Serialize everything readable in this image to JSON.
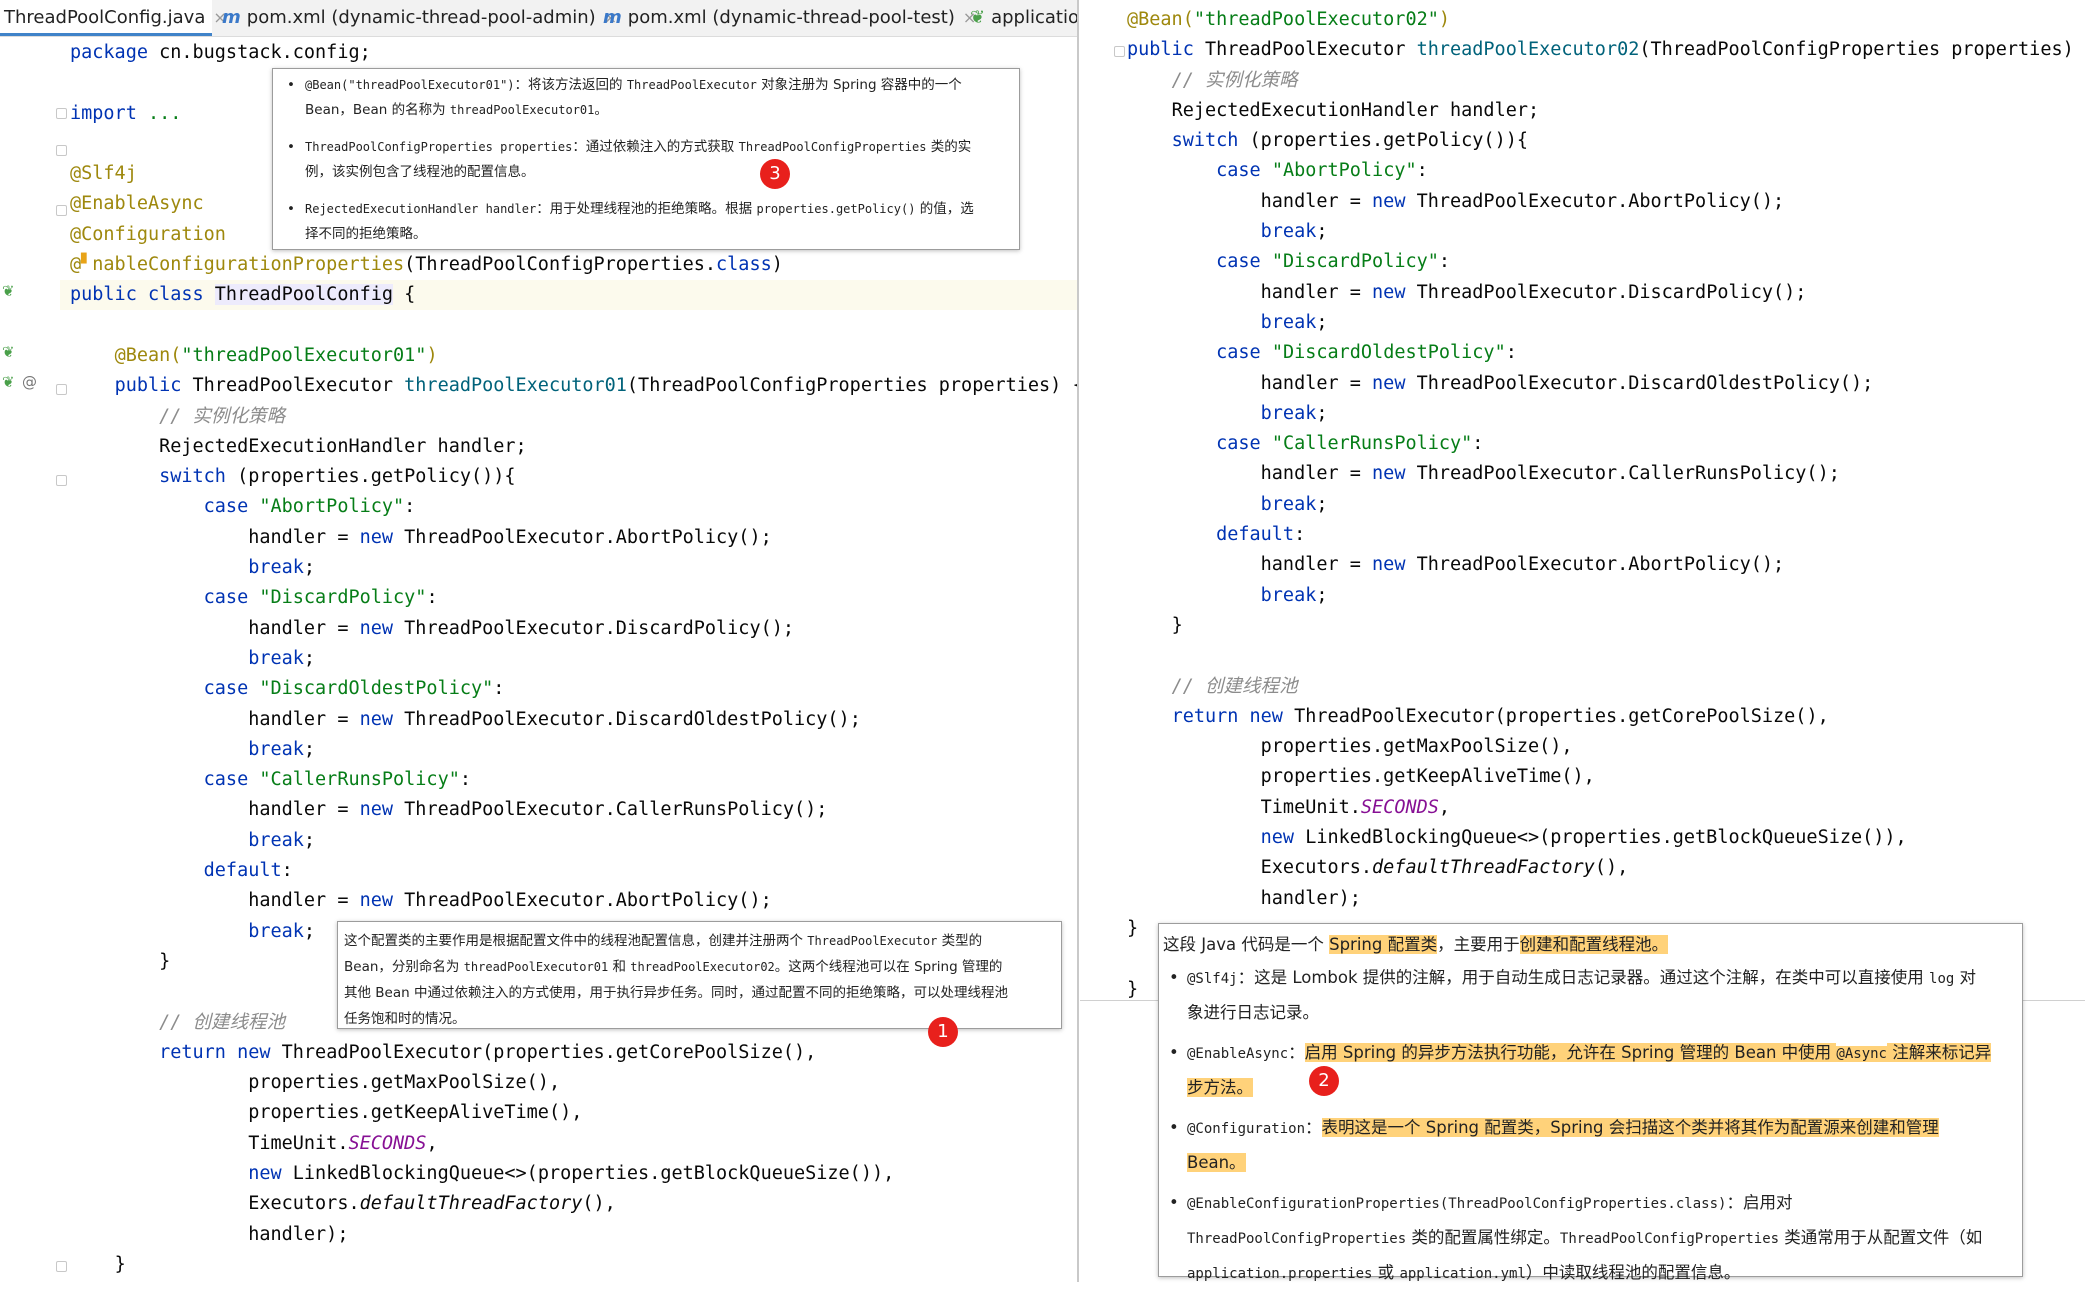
{
  "tabs": [
    {
      "label": "ThreadPoolConfig.java",
      "icon": "java-file-icon"
    },
    {
      "label": "pom.xml (dynamic-thread-pool-admin)",
      "icon": "maven-file-icon"
    },
    {
      "label": "pom.xml (dynamic-thread-pool-test)",
      "icon": "maven-file-icon"
    },
    {
      "label": "applicatio",
      "icon": "spring-config-icon"
    }
  ],
  "code": {
    "package_kw": "package",
    "package_name": "cn.bugstack.config;",
    "import_kw": "import",
    "import_dots": "...",
    "ann_slf4j": "@Slf4j",
    "ann_async": "@EnableAsync",
    "ann_config": "@Configuration",
    "ann_ecp_head": "@",
    "ann_ecp_tail": "nableConfigurationProperties",
    "ecp_arg": "(ThreadPoolConfigProperties.",
    "class_kw": "class",
    "ecp_close": ")",
    "public_class": "public class",
    "class_name": "ThreadPoolConfig",
    "open_brace": "{",
    "bean_ann": "@Bean(",
    "bean_name1": "\"threadPoolExecutor01\"",
    "bean_name2": "\"threadPoolExecutor02\"",
    "close_paren": ")",
    "public_kw": "public",
    "return_type": "ThreadPoolExecutor",
    "method1": "threadPoolExecutor01",
    "method2": "threadPoolExecutor02",
    "params": "(ThreadPoolConfigProperties properties) {",
    "comment_instantiate": "// 实例化策略",
    "handler_decl": "RejectedExecutionHandler handler;",
    "switch_kw": "switch",
    "switch_expr": "(properties.getPolicy()){",
    "case_kw": "case",
    "cases": [
      {
        "label": "\"AbortPolicy\"",
        "ctor": "ThreadPoolExecutor.AbortPolicy();"
      },
      {
        "label": "\"DiscardPolicy\"",
        "ctor": "ThreadPoolExecutor.DiscardPolicy();"
      },
      {
        "label": "\"DiscardOldestPolicy\"",
        "ctor": "ThreadPoolExecutor.DiscardOldestPolicy();"
      },
      {
        "label": "\"CallerRunsPolicy\"",
        "ctor": "ThreadPoolExecutor.CallerRunsPolicy();"
      }
    ],
    "colon": ":",
    "handler_assign": "handler = ",
    "new_kw": "new",
    "break_kw": "break",
    "semicolon": ";",
    "default_kw": "default",
    "default_ctor": "ThreadPoolExecutor.AbortPolicy();",
    "close_brace": "}",
    "comment_create": "// 创建线程池",
    "return_kw": "return",
    "return_ctor": "ThreadPoolExecutor(properties.getCorePoolSize(),",
    "arg_max": "properties.getMaxPoolSize(),",
    "arg_keep": "properties.getKeepAliveTime(),",
    "arg_unit_a": "TimeUnit.",
    "arg_unit_b": "SECONDS",
    "arg_unit_c": ",",
    "arg_queue": "LinkedBlockingQueue<>(properties.getBlockQueueSize()),",
    "arg_exec_a": "Executors.",
    "arg_exec_b": "defaultThreadFactory",
    "arg_exec_c": "(),",
    "arg_handler": "handler);"
  },
  "popup_top": {
    "items": [
      {
        "code": "@Bean(\"threadPoolExecutor01\")",
        "text1": "：将该方法返回的 ",
        "code2": "ThreadPoolExecutor",
        "text2": " 对象注册为 Spring 容器中的一个",
        "line2a": "Bean，Bean 的名称为 ",
        "line2code": "threadPoolExecutor01",
        "line2b": "。"
      },
      {
        "code": "ThreadPoolConfigProperties properties",
        "text1": "：通过依赖注入的方式获取 ",
        "code2": "ThreadPoolConfigProperties",
        "text2": " 类的实",
        "line2a": "例，该实例包含了线程池的配置信息。",
        "line2code": "",
        "line2b": ""
      },
      {
        "code": "RejectedExecutionHandler handler",
        "text1": "：用于处理线程池的拒绝策略。根据 ",
        "code2": "properties.getPolicy()",
        "text2": " 的值，选",
        "line2a": "择不同的拒绝策略。",
        "line2code": "",
        "line2b": ""
      }
    ],
    "badge": "3"
  },
  "popup_mid": {
    "l1a": "这个配置类的主要作用是根据配置文件中的线程池配置信息，创建并注册两个 ",
    "l1code": "ThreadPoolExecutor",
    "l1b": " 类型的",
    "l2a": "Bean，分别命名为 ",
    "l2code1": "threadPoolExecutor01",
    "l2b": " 和 ",
    "l2code2": "threadPoolExecutor02",
    "l2c": "。这两个线程池可以在 Spring 管理的",
    "l3": "其他 Bean 中通过依赖注入的方式使用，用于执行异步任务。同时，通过配置不同的拒绝策略，可以处理线程池",
    "l4": "任务饱和时的情况。",
    "badge": "1"
  },
  "popup_bottom": {
    "head_a": "这段 Java 代码是一个 ",
    "head_hl1": "Spring 配置类",
    "head_b": "，主要用于",
    "head_hl2": "创建和配置线程池。",
    "b1_code": "@Slf4j",
    "b1_a": "：这是 Lombok 提供的注解，用于自动生成日志记录器。通过这个注解，在类中可以直接使用 ",
    "b1_code2": "log",
    "b1_b": " 对",
    "b1_l2": "象进行日志记录。",
    "b2_code": "@EnableAsync",
    "b2_colon": "：",
    "b2_hl1": "启用 Spring 的异步方法执行功能，允许在 Spring 管理的 Bean 中使用 ",
    "b2_code2": "@Async",
    "b2_hl2": " 注解",
    "b2_b": "来标记异",
    "b2_l2": "步方法。",
    "b3_code": "@Configuration",
    "b3_colon": "：",
    "b3_hl": "表明这是一个 Spring 配置类，Spring 会扫描这个类并将其作为配置源来创建和管理",
    "b3_l2": "Bean。",
    "b4_code": "@EnableConfigurationProperties(ThreadPoolConfigProperties.class)",
    "b4_a": "：启用对",
    "b4_l2code": "ThreadPoolConfigProperties",
    "b4_l2a": " 类的配置属性绑定。",
    "b4_l2code2": "ThreadPoolConfigProperties",
    "b4_l2b": " 类通常用于从配置文件（如",
    "b4_l3code": "application.properties",
    "b4_l3a": " 或 ",
    "b4_l3code2": "application.yml",
    "b4_l3b": "）中读取线程池的配置信息。",
    "badge": "2"
  },
  "colors": {
    "keyword": "#0033b3",
    "annotation": "#9e880d",
    "string": "#067d17",
    "method": "#00627a",
    "comment": "#8c8c8c",
    "highlight": "#ffd27a",
    "badge": "#e8201c"
  }
}
